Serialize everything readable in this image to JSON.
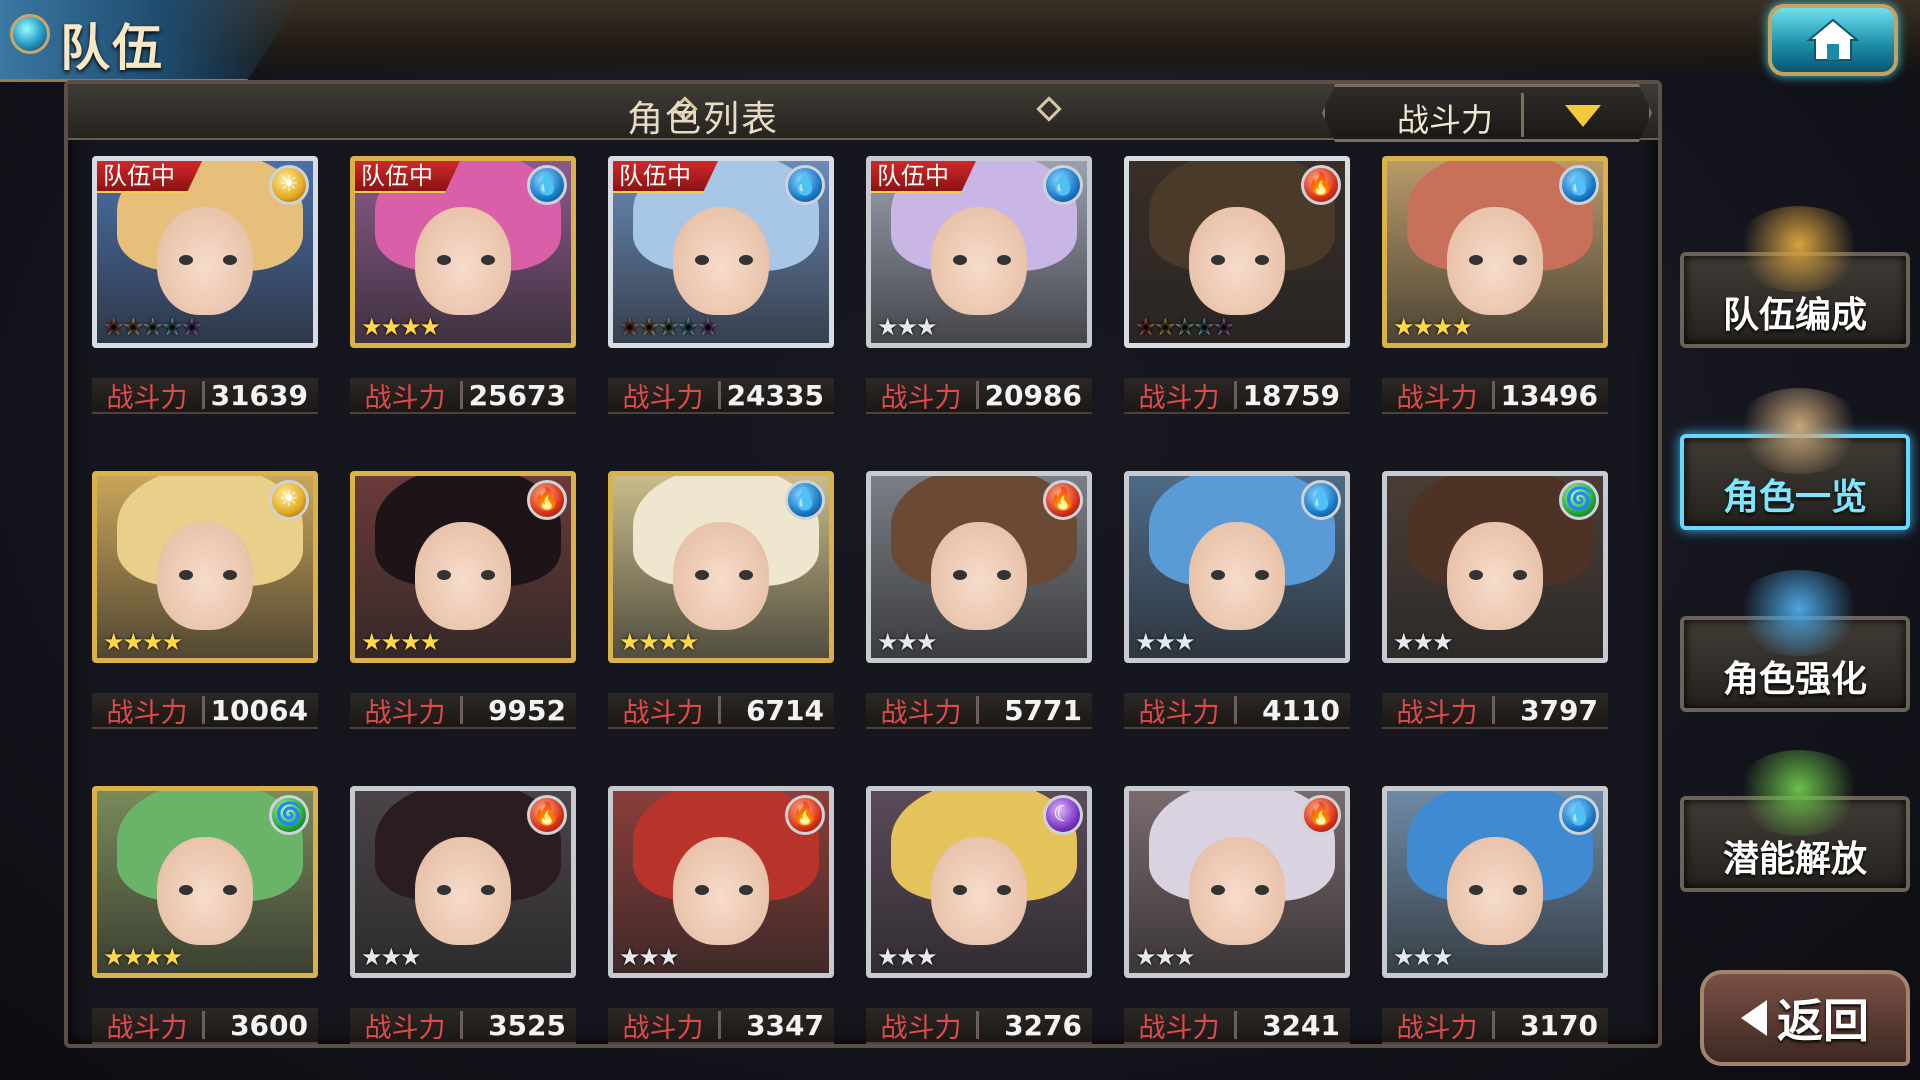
{
  "header": {
    "title": "队伍",
    "home_icon": "home-icon"
  },
  "panel": {
    "title": "角色列表",
    "sort": {
      "label": "战斗力",
      "icon": "chevron-down-icon"
    }
  },
  "labels": {
    "power": "战斗力",
    "in_team": "队伍中"
  },
  "characters": [
    {
      "in_team": true,
      "element": "light",
      "stars": 5,
      "rarity": "rainbow",
      "power": "31639"
    },
    {
      "in_team": true,
      "element": "water",
      "stars": 4,
      "rarity": "gold",
      "power": "25673"
    },
    {
      "in_team": true,
      "element": "water",
      "stars": 5,
      "rarity": "rainbow",
      "power": "24335"
    },
    {
      "in_team": true,
      "element": "water",
      "stars": 3,
      "rarity": "silver",
      "power": "20986"
    },
    {
      "in_team": false,
      "element": "fire",
      "stars": 5,
      "rarity": "rainbow",
      "power": "18759"
    },
    {
      "in_team": false,
      "element": "water",
      "stars": 4,
      "rarity": "gold",
      "power": "13496"
    },
    {
      "in_team": false,
      "element": "light",
      "stars": 4,
      "rarity": "gold",
      "power": "10064"
    },
    {
      "in_team": false,
      "element": "fire",
      "stars": 4,
      "rarity": "gold",
      "power": "9952"
    },
    {
      "in_team": false,
      "element": "water",
      "stars": 4,
      "rarity": "gold",
      "power": "6714"
    },
    {
      "in_team": false,
      "element": "fire",
      "stars": 3,
      "rarity": "silver",
      "power": "5771"
    },
    {
      "in_team": false,
      "element": "water",
      "stars": 3,
      "rarity": "silver",
      "power": "4110"
    },
    {
      "in_team": false,
      "element": "wind",
      "stars": 3,
      "rarity": "silver",
      "power": "3797"
    },
    {
      "in_team": false,
      "element": "wind",
      "stars": 4,
      "rarity": "gold",
      "power": "3600"
    },
    {
      "in_team": false,
      "element": "fire",
      "stars": 3,
      "rarity": "silver",
      "power": "3525"
    },
    {
      "in_team": false,
      "element": "fire",
      "stars": 3,
      "rarity": "silver",
      "power": "3347"
    },
    {
      "in_team": false,
      "element": "dark",
      "stars": 3,
      "rarity": "silver",
      "power": "3276"
    },
    {
      "in_team": false,
      "element": "fire",
      "stars": 3,
      "rarity": "silver",
      "power": "3241"
    },
    {
      "in_team": false,
      "element": "water",
      "stars": 3,
      "rarity": "silver",
      "power": "3170"
    }
  ],
  "side_menu": [
    {
      "label": "队伍编成",
      "active": false
    },
    {
      "label": "角色一览",
      "active": true
    },
    {
      "label": "角色强化",
      "active": false
    },
    {
      "label": "潜能解放",
      "active": false
    }
  ],
  "back": {
    "label": "返回"
  },
  "colors": {
    "accent": "#66d7ff",
    "power_label": "#e04a4a",
    "team_badge": "#d42a2a"
  }
}
